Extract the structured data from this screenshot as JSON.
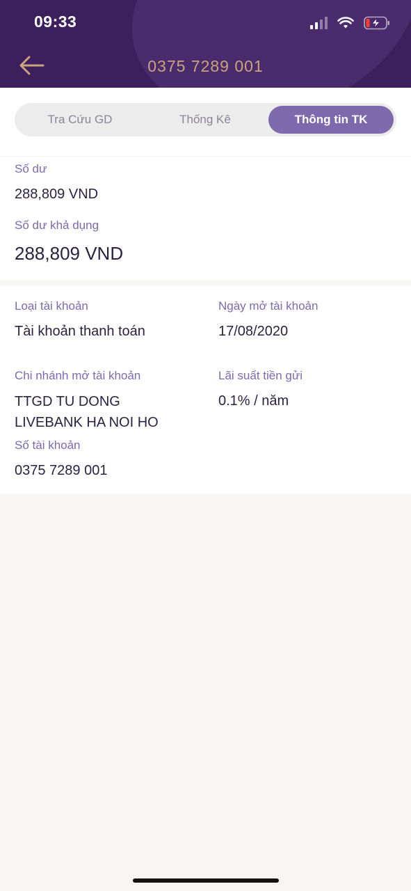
{
  "status_bar": {
    "time": "09:33"
  },
  "header": {
    "title": "0375 7289 001",
    "back_icon": "arrow-left-icon"
  },
  "tabs": [
    {
      "label": "Tra Cứu GD",
      "active": false
    },
    {
      "label": "Thống Kê",
      "active": false
    },
    {
      "label": "Thông tin TK",
      "active": true
    }
  ],
  "balance": {
    "label": "Số dư",
    "value": "288,809 VND",
    "available_label": "Số dư khả dụng",
    "available_value": "288,809 VND"
  },
  "account_info": {
    "type_label": "Loại tài khoản",
    "type_value": "Tài khoản thanh toán",
    "open_date_label": "Ngày mở tài khoản",
    "open_date_value": "17/08/2020",
    "branch_label": "Chi nhánh mở tài khoản",
    "branch_value_line1": "TTGD TU DONG",
    "branch_value_line2": "LIVEBANK HA NOI HO",
    "rate_label": "Lãi suất tiền gửi",
    "rate_value": "0.1% / năm",
    "number_label": "Số tài khoản",
    "number_value": "0375 7289 001"
  },
  "colors": {
    "header_bg": "#3d1f5e",
    "title_gold": "#c9a57a",
    "accent_purple": "#7c6aac",
    "text_dark": "#2c2240"
  }
}
